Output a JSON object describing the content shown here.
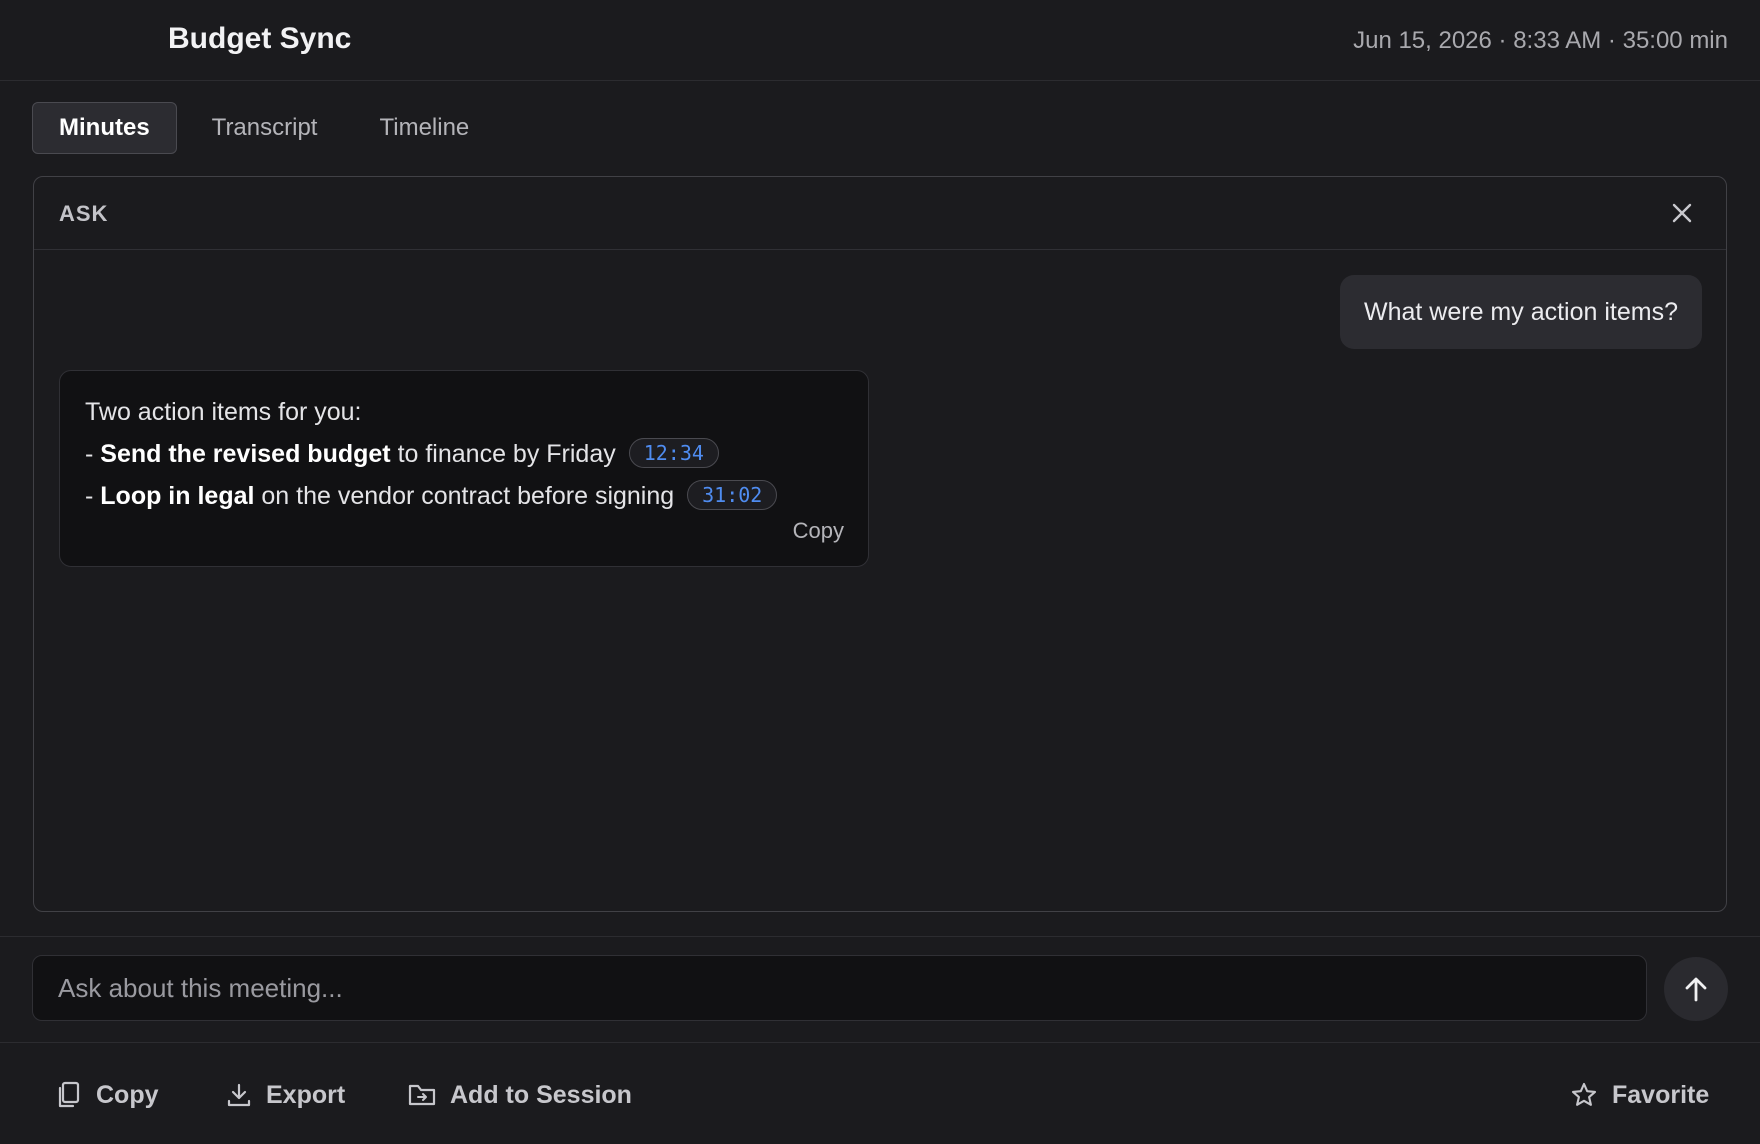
{
  "header": {
    "title": "Budget Sync",
    "meta": "Jun 15, 2026 · 8:33 AM · 35:00 min"
  },
  "tabs": [
    {
      "label": "Minutes",
      "active": true
    },
    {
      "label": "Transcript",
      "active": false
    },
    {
      "label": "Timeline",
      "active": false
    }
  ],
  "ask_panel": {
    "label": "ASK",
    "close_icon": "close-icon",
    "user_message": "What were my action items?",
    "answer": {
      "intro": "Two action items for you:",
      "items": [
        {
          "prefix": "- ",
          "bold": "Send the revised budget",
          "rest": " to finance by Friday",
          "timestamp": "12:34"
        },
        {
          "prefix": "- ",
          "bold": "Loop in legal",
          "rest": " on the vendor contract before signing",
          "timestamp": "31:02"
        }
      ],
      "copy_label": "Copy"
    }
  },
  "input": {
    "placeholder": "Ask about this meeting...",
    "value": "",
    "send_icon": "arrow-up-icon"
  },
  "footer": {
    "copy_label": "Copy",
    "export_label": "Export",
    "add_to_session_label": "Add to Session",
    "favorite_label": "Favorite"
  },
  "colors": {
    "background": "#1b1b1e",
    "timestamp_accent": "#4f8cf0"
  }
}
